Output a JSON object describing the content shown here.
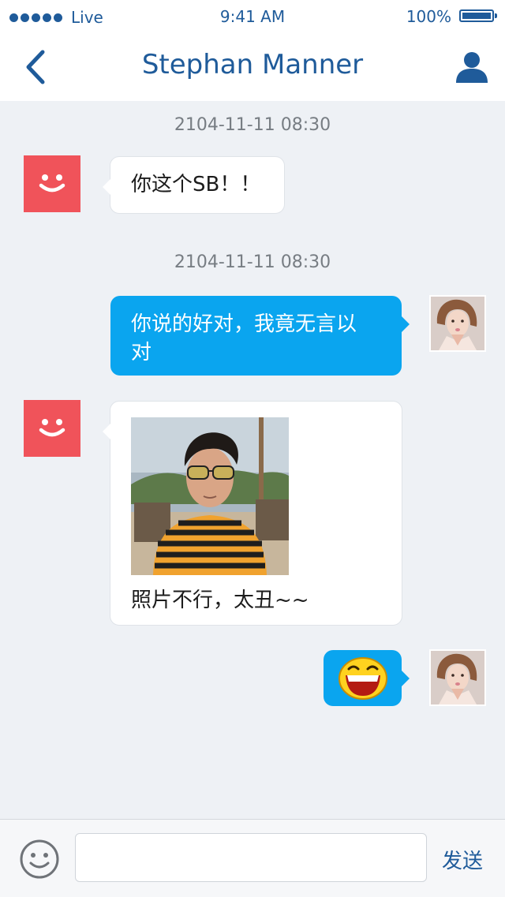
{
  "status_bar": {
    "carrier": "Live",
    "time": "9:41 AM",
    "battery_percent": "100%",
    "battery_level": 1.0,
    "signal_dots": 5
  },
  "nav": {
    "title": "Stephan Manner",
    "back_icon": "chevron-left-icon",
    "profile_icon": "person-icon"
  },
  "messages": [
    {
      "timestamp": "2104-11-11  08:30"
    },
    {
      "side": "in",
      "text": "你这个SB！！"
    },
    {
      "timestamp": "2104-11-11  08:30"
    },
    {
      "side": "out",
      "lines": [
        "你说的好对，我竟无言以",
        "对"
      ]
    },
    {
      "side": "in",
      "caption": "照片不行，太丑~~",
      "has_photo": true
    },
    {
      "side": "out",
      "emoji": "laughing-face-icon"
    }
  ],
  "input_bar": {
    "emoji_icon": "smiley-icon",
    "placeholder": "",
    "value": "",
    "send_label": "发送"
  },
  "colors": {
    "accent": "#1f5b9a",
    "bubble_out": "#0aa5ef",
    "bot_avatar": "#f0535a",
    "background": "#eef1f5"
  }
}
